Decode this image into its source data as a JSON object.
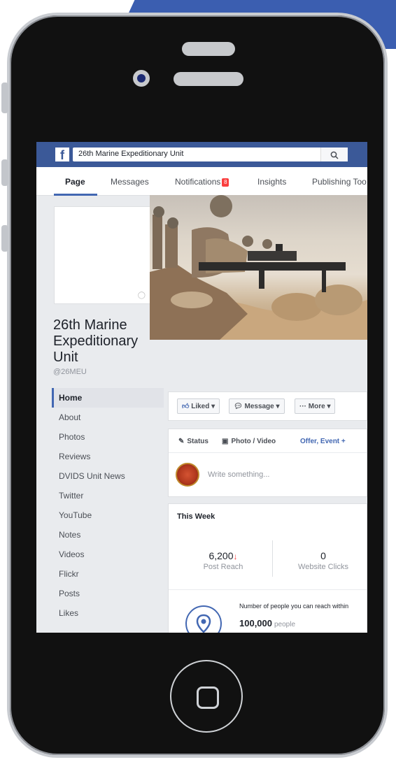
{
  "fb": {
    "logo": "f",
    "search_value": "26th Marine Expeditionary Unit",
    "search_icon": "magnifier"
  },
  "tabs": [
    {
      "label": "Page",
      "active": true
    },
    {
      "label": "Messages"
    },
    {
      "label": "Notifications",
      "badge": "8"
    },
    {
      "label": "Insights"
    },
    {
      "label": "Publishing Too"
    }
  ],
  "page": {
    "name": "26th Marine Expeditionary Unit",
    "handle": "@26MEU"
  },
  "nav": [
    {
      "label": "Home",
      "active": true
    },
    {
      "label": "About"
    },
    {
      "label": "Photos"
    },
    {
      "label": "Reviews"
    },
    {
      "label": "DVIDS Unit News"
    },
    {
      "label": "Twitter"
    },
    {
      "label": "YouTube"
    },
    {
      "label": "Notes"
    },
    {
      "label": "Videos"
    },
    {
      "label": "Flickr"
    },
    {
      "label": "Posts"
    },
    {
      "label": "Likes"
    }
  ],
  "actions": {
    "liked": "Liked ▾",
    "message": "Message ▾",
    "more": "··· More ▾"
  },
  "composer": {
    "status": "Status",
    "photo_video": "Photo / Video",
    "offer_event": "Offer, Event +",
    "placeholder": "Write something..."
  },
  "this_week": {
    "title": "This Week",
    "post_reach_value": "6,200",
    "post_reach_label": "Post Reach",
    "website_clicks_value": "0",
    "website_clicks_label": "Website Clicks",
    "reach_text": "Number of people you can reach within",
    "reach_number": "100,000",
    "reach_unit": "people"
  },
  "colors": {
    "facebook_blue": "#3b5998",
    "accent": "#4267b2",
    "alert_red": "#fa3e3e"
  }
}
